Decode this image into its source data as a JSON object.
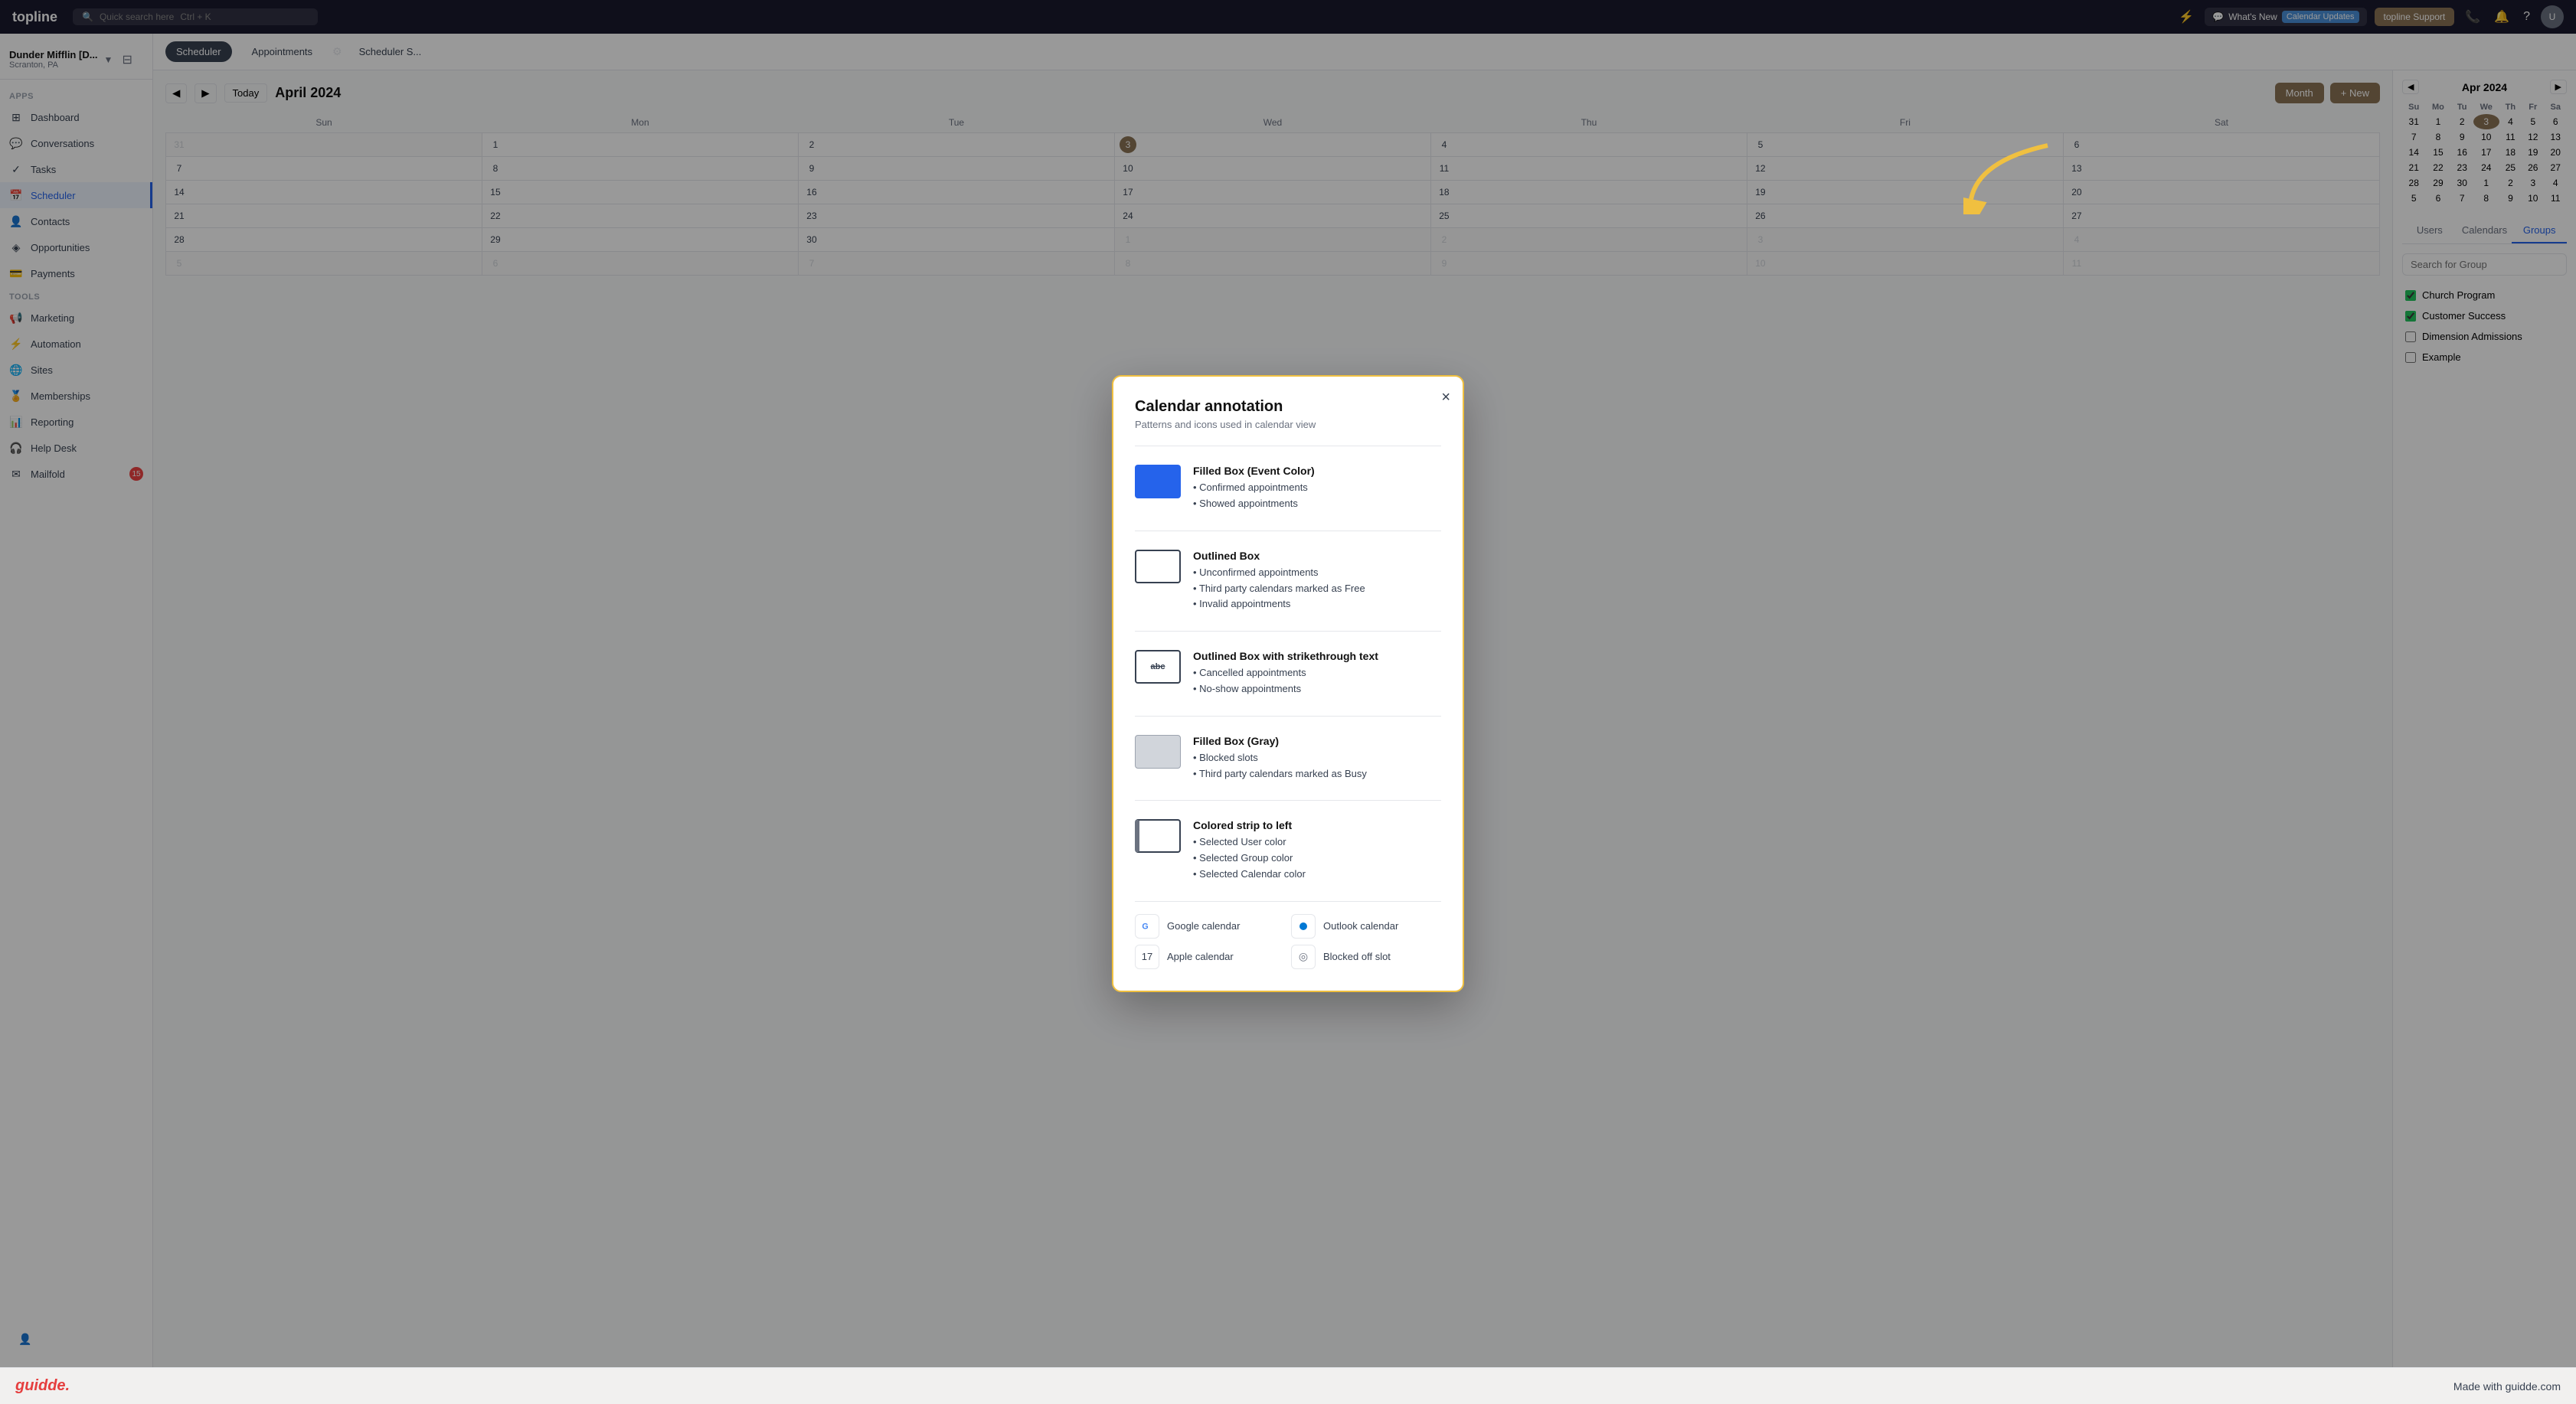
{
  "topnav": {
    "logo": "topline",
    "search_placeholder": "Quick search here",
    "search_shortcut": "Ctrl + K",
    "whats_new_label": "What's New",
    "calendar_updates_badge": "Calendar Updates",
    "support_label": "topline Support",
    "icons": [
      "lightning",
      "phone",
      "bell",
      "question",
      "avatar"
    ]
  },
  "sidebar": {
    "org_name": "Dunder Mifflin [D...",
    "org_location": "Scranton, PA",
    "sections": [
      {
        "label": "Apps",
        "items": [
          {
            "id": "dashboard",
            "label": "Dashboard",
            "icon": "⊞"
          },
          {
            "id": "conversations",
            "label": "Conversations",
            "icon": "💬"
          },
          {
            "id": "tasks",
            "label": "Tasks",
            "icon": "✓"
          },
          {
            "id": "scheduler",
            "label": "Scheduler",
            "icon": "📅",
            "active": true
          },
          {
            "id": "contacts",
            "label": "Contacts",
            "icon": "👤"
          },
          {
            "id": "opportunities",
            "label": "Opportunities",
            "icon": "◈"
          },
          {
            "id": "payments",
            "label": "Payments",
            "icon": "💳"
          }
        ]
      },
      {
        "label": "Tools",
        "items": [
          {
            "id": "marketing",
            "label": "Marketing",
            "icon": "📢"
          },
          {
            "id": "automation",
            "label": "Automation",
            "icon": "⚡"
          },
          {
            "id": "sites",
            "label": "Sites",
            "icon": "🌐"
          },
          {
            "id": "memberships",
            "label": "Memberships",
            "icon": "🏅"
          },
          {
            "id": "reporting",
            "label": "Reporting",
            "icon": "📊"
          },
          {
            "id": "helpdesk",
            "label": "Help Desk",
            "icon": "🎧"
          },
          {
            "id": "mailfold",
            "label": "Mailfold",
            "icon": "✉"
          }
        ]
      }
    ]
  },
  "scheduler": {
    "tabs": [
      "Scheduler",
      "Appointments",
      "Scheduler S..."
    ],
    "active_tab": "Scheduler",
    "nav": {
      "today_label": "Today",
      "month_label": "April 2024",
      "view_label": "Month",
      "new_label": "+ New"
    },
    "days_of_week": [
      "Sun",
      "Mon",
      "Tue",
      "Wed",
      "Thu",
      "Fri",
      "Sat"
    ],
    "weeks": [
      [
        {
          "num": "31",
          "other": true
        },
        {
          "num": "1"
        },
        {
          "num": "2"
        },
        {
          "num": "3",
          "today": true
        },
        {
          "num": "4"
        },
        {
          "num": "5"
        },
        {
          "num": "6"
        }
      ],
      [
        {
          "num": "7"
        },
        {
          "num": "8"
        },
        {
          "num": "9"
        },
        {
          "num": "10"
        },
        {
          "num": "11"
        },
        {
          "num": "12"
        },
        {
          "num": "13"
        }
      ],
      [
        {
          "num": "14"
        },
        {
          "num": "15"
        },
        {
          "num": "16"
        },
        {
          "num": "17"
        },
        {
          "num": "18"
        },
        {
          "num": "19"
        },
        {
          "num": "20"
        }
      ],
      [
        {
          "num": "21"
        },
        {
          "num": "22"
        },
        {
          "num": "23"
        },
        {
          "num": "24"
        },
        {
          "num": "25"
        },
        {
          "num": "26"
        },
        {
          "num": "27"
        }
      ],
      [
        {
          "num": "28"
        },
        {
          "num": "29"
        },
        {
          "num": "30"
        },
        {
          "num": "1",
          "other": true
        },
        {
          "num": "2",
          "other": true
        },
        {
          "num": "3",
          "other": true
        },
        {
          "num": "4",
          "other": true
        }
      ],
      [
        {
          "num": "5",
          "other": true
        },
        {
          "num": "6",
          "other": true
        },
        {
          "num": "7",
          "other": true
        },
        {
          "num": "8",
          "other": true
        },
        {
          "num": "9",
          "other": true
        },
        {
          "num": "10",
          "other": true
        },
        {
          "num": "11",
          "other": true
        }
      ]
    ]
  },
  "right_sidebar": {
    "mini_cal_title": "Apr 2024",
    "mini_cal_days": [
      "Su",
      "Mo",
      "Tu",
      "We",
      "Th",
      "Fr",
      "Sa"
    ],
    "mini_cal_weeks": [
      [
        "31",
        "1",
        "2",
        "3",
        "4",
        "5",
        "6"
      ],
      [
        "7",
        "8",
        "9",
        "10",
        "11",
        "12",
        "13"
      ],
      [
        "14",
        "15",
        "16",
        "17",
        "18",
        "19",
        "20"
      ],
      [
        "21",
        "22",
        "23",
        "24",
        "25",
        "26",
        "27"
      ],
      [
        "28",
        "29",
        "30",
        "1",
        "2",
        "3",
        "4"
      ],
      [
        "5",
        "6",
        "7",
        "8",
        "9",
        "10",
        "11"
      ]
    ],
    "mini_today": "3",
    "filter_tabs": [
      "Users",
      "Calendars",
      "Groups"
    ],
    "active_filter": "Groups",
    "search_placeholder": "Search for Group",
    "groups": [
      {
        "label": "Church Program",
        "checked": true
      },
      {
        "label": "Customer Success",
        "checked": true
      },
      {
        "label": "Dimension Admissions",
        "checked": false
      },
      {
        "label": "Example",
        "checked": false
      }
    ]
  },
  "modal": {
    "title": "Calendar annotation",
    "subtitle": "Patterns and icons used in calendar view",
    "close_label": "×",
    "annotations": [
      {
        "type": "filled-blue",
        "title": "Filled Box (Event Color)",
        "items": [
          "Confirmed appointments",
          "Showed appointments"
        ]
      },
      {
        "type": "outlined",
        "title": "Outlined Box",
        "items": [
          "Unconfirmed appointments",
          "Third party calendars marked as Free",
          "Invalid appointments"
        ]
      },
      {
        "type": "outlined-strike",
        "title": "Outlined Box with strikethrough text",
        "items": [
          "Cancelled appointments",
          "No-show appointments"
        ]
      },
      {
        "type": "filled-gray",
        "title": "Filled Box (Gray)",
        "items": [
          "Blocked slots",
          "Third party calendars marked as Busy"
        ]
      },
      {
        "type": "colored-strip",
        "title": "Colored strip to left",
        "items": [
          "Selected User color",
          "Selected Group color",
          "Selected Calendar color"
        ]
      }
    ],
    "icons": [
      {
        "type": "google",
        "label": "Google calendar",
        "symbol": "G"
      },
      {
        "type": "outlook",
        "label": "Outlook calendar",
        "symbol": "⬤"
      },
      {
        "type": "apple",
        "label": "Apple calendar",
        "symbol": "17"
      },
      {
        "type": "blocked",
        "label": "Blocked off slot",
        "symbol": "◎"
      }
    ]
  },
  "bottom_bar": {
    "logo": "guidde.",
    "tagline": "Made with guidde.com"
  }
}
